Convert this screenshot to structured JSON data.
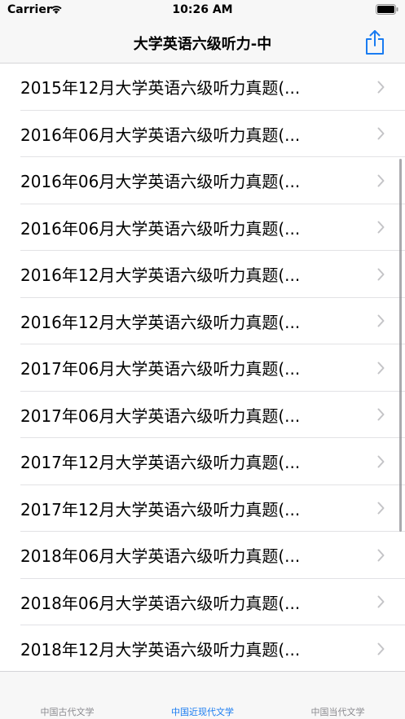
{
  "status_bar": {
    "carrier": "Carrier",
    "time": "10:26 AM"
  },
  "nav": {
    "title": "大学英语六级听力-中",
    "share_icon": "share-icon"
  },
  "list": {
    "items": [
      "2015年12月大学英语六级听力真题(...",
      "2016年06月大学英语六级听力真题(...",
      "2016年06月大学英语六级听力真题(...",
      "2016年06月大学英语六级听力真题(...",
      "2016年12月大学英语六级听力真题(...",
      "2016年12月大学英语六级听力真题(...",
      "2017年06月大学英语六级听力真题(...",
      "2017年06月大学英语六级听力真题(...",
      "2017年12月大学英语六级听力真题(...",
      "2017年12月大学英语六级听力真题(...",
      "2018年06月大学英语六级听力真题(...",
      "2018年06月大学英语六级听力真题(...",
      "2018年12月大学英语六级听力真题(..."
    ]
  },
  "tabs": [
    {
      "label": "中国古代文学",
      "active": false
    },
    {
      "label": "中国近现代文学",
      "active": true
    },
    {
      "label": "中国当代文学",
      "active": false
    }
  ],
  "colors": {
    "accent": "#1a7cf1",
    "bar_background": "#f7f7f7",
    "inactive_tab": "#8a8a8f"
  }
}
